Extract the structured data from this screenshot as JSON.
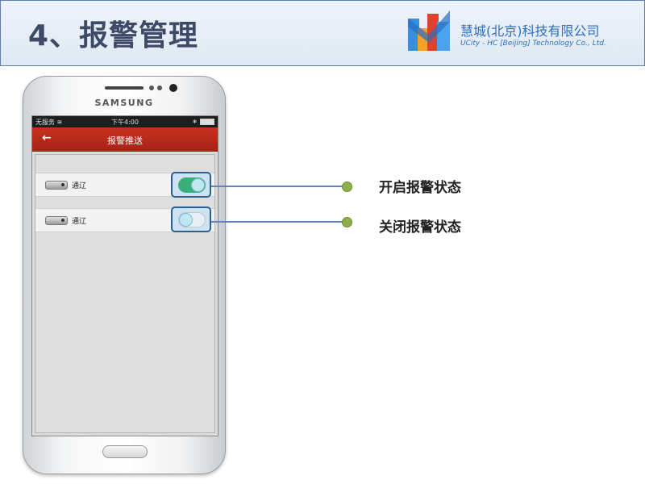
{
  "header": {
    "title": "4、报警管理",
    "company_cn": "慧城(北京)科技有限公司",
    "company_en": "UCity - HC [Beijing] Technology Co., Ltd."
  },
  "phone": {
    "brand": "SAMSUNG",
    "statusbar": {
      "carrier": "无服务",
      "time": "下午4:00"
    },
    "titlebar": {
      "title": "报警推送"
    },
    "rows": [
      {
        "label": "通辽",
        "toggle": "on"
      },
      {
        "label": "通辽",
        "toggle": "off"
      }
    ]
  },
  "callouts": [
    {
      "text": "开启报警状态"
    },
    {
      "text": "关闭报警状态"
    }
  ],
  "colors": {
    "titlebar": "#b52a18",
    "toggle_on": "#39b07a",
    "callout_line": "#5b86c5",
    "callout_dot": "#8eb04a",
    "company": "#2a6fc0"
  },
  "icons": {
    "back": "arrow-left-icon",
    "wifi": "wifi-icon",
    "bluetooth": "bluetooth-icon",
    "battery": "battery-icon",
    "device": "camera-device-icon"
  }
}
